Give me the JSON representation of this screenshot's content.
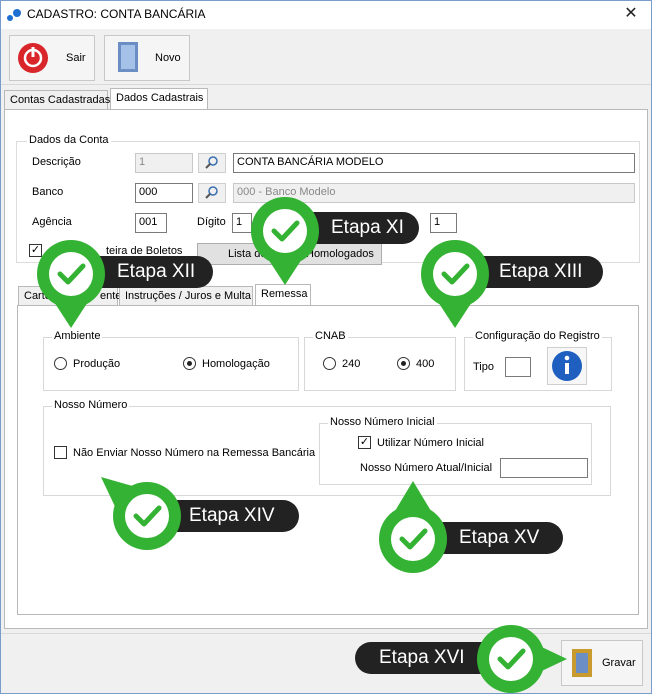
{
  "window": {
    "title": "CADASTRO: CONTA BANCÁRIA",
    "close": "✕"
  },
  "toolbar": {
    "exit_label": "Sair",
    "new_label": "Novo"
  },
  "tabs": {
    "main": [
      "Contas Cadastradas",
      "Dados Cadastrais"
    ]
  },
  "dados_conta": {
    "group_title": "Dados da Conta",
    "descricao_label": "Descrição",
    "descricao_code": "1",
    "descricao_value": "CONTA BANCÁRIA MODELO",
    "banco_label": "Banco",
    "banco_code": "000",
    "banco_name": "000 - Banco Modelo",
    "agencia_label": "Agência",
    "agencia_value": "001",
    "digito_label": "Dígito",
    "digito_value": "1",
    "conta_digito_value": "1",
    "carteira_label": "teira de Boletos",
    "lista_label": "Lista de",
    "homologados_label": "Homologados"
  },
  "subtabs": [
    "Carte",
    "ente",
    "Instruções / Juros e Multa",
    "Remessa"
  ],
  "remessa": {
    "ambiente_title": "Ambiente",
    "producao": "Produção",
    "homologacao": "Homologação",
    "cnab_title": "CNAB",
    "cnab_240": "240",
    "cnab_400": "400",
    "config_title": "Configuração do Registro",
    "tipo_label": "Tipo",
    "nosso_numero_title": "Nosso Número",
    "nao_enviar_label": "Não Enviar Nosso Número na Remessa Bancária",
    "nn_inicial_title": "Nosso Número Inicial",
    "utilizar_label": "Utilizar Número Inicial",
    "nn_atual_label": "Nosso Número Atual/Inicial"
  },
  "bottom": {
    "save_label": "Gravar"
  },
  "steps": {
    "s11": "Etapa XI",
    "s12": "Etapa XII",
    "s13": "Etapa XIII",
    "s14": "Etapa XIV",
    "s15": "Etapa XV",
    "s16": "Etapa XVI"
  },
  "colors": {
    "badge_green": "#34b233",
    "badge_dark": "#222222",
    "info_blue": "#1f5fbf",
    "exit_red": "#d9262b"
  }
}
